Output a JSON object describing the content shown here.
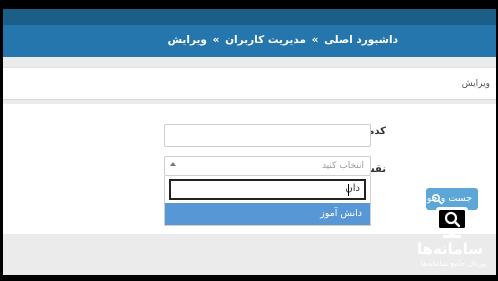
{
  "breadcrumb": {
    "items": [
      "داشبورد اصلی",
      "مدیریت کاربران",
      "ویرایش"
    ],
    "separator": "»"
  },
  "subheader": {
    "title": "ویرایش"
  },
  "form": {
    "name_label": "کدملی",
    "name_value": "",
    "role_label": "نقش",
    "role_placeholder": "انتخاب کنید",
    "search_query": "دان",
    "option": "دانش آموز",
    "search_button": "جست و جو"
  },
  "logo": {
    "brand": "سامانه‌ها",
    "tagline": "پورتال جامع سامانه‌ها"
  },
  "colors": {
    "header": "#2576ad",
    "option_highlight": "#5897d6",
    "button": "#5da7d8"
  },
  "icons": {
    "search": "search-icon",
    "dropdown": "chevron-up-icon",
    "logo": "monitor-search-icon"
  }
}
